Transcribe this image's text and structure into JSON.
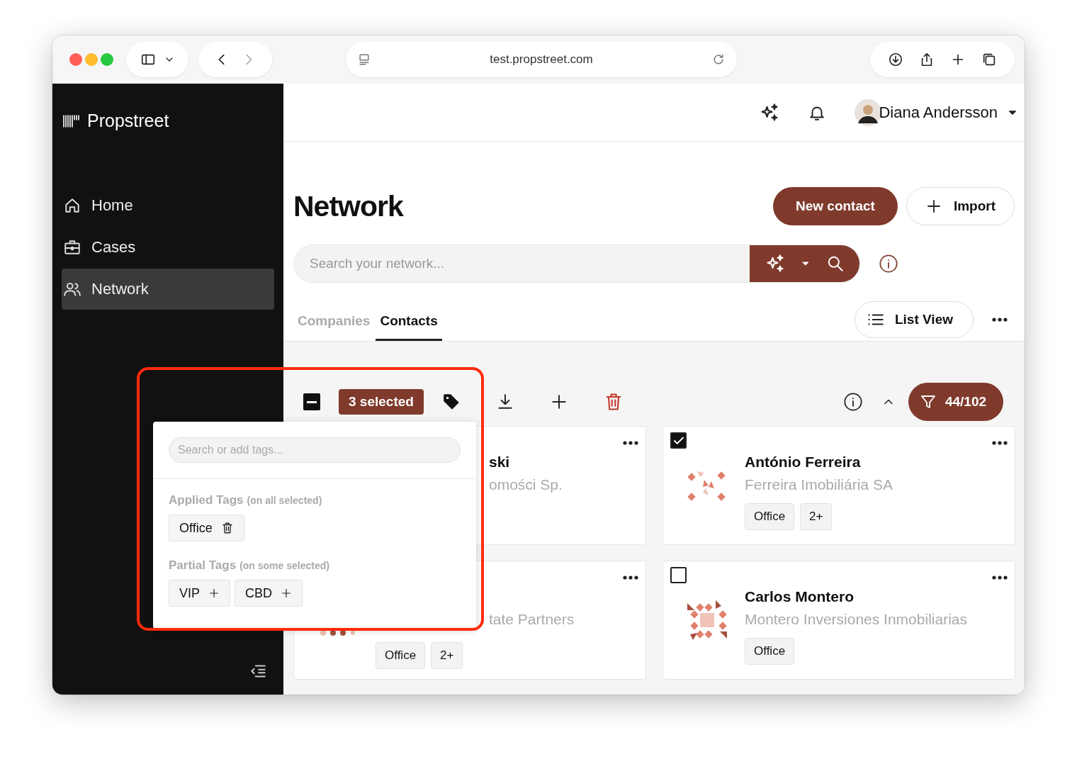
{
  "browser": {
    "url": "test.propstreet.com"
  },
  "sidebar": {
    "logo": "Propstreet",
    "items": [
      {
        "label": "Home",
        "kind": "home",
        "selected": false
      },
      {
        "label": "Cases",
        "kind": "cases",
        "selected": false
      },
      {
        "label": "Network",
        "kind": "network",
        "selected": true
      }
    ]
  },
  "header": {
    "user": "Diana Andersson"
  },
  "page": {
    "title": "Network",
    "new_button": "New contact",
    "import_button": "Import",
    "search": {
      "placeholder": "Search your network..."
    },
    "tabs": [
      {
        "label": "Companies",
        "selected": false
      },
      {
        "label": "Contacts",
        "selected": true
      }
    ],
    "view_button": "List View"
  },
  "toolbar": {
    "select_all": {
      "indeterminate": true
    },
    "selected_count": "3 selected",
    "filter_count": "44/102"
  },
  "tag_popup": {
    "placeholder": "Search or add tags...",
    "applied": {
      "title": "Applied Tags",
      "note": "(on all selected)",
      "tags": [
        "Office"
      ]
    },
    "partial": {
      "title": "Partial Tags",
      "note": "(on some selected)",
      "tags": [
        "VIP",
        "CBD"
      ]
    }
  },
  "contacts": [
    {
      "kind": "covered",
      "name": "ski",
      "company": "omości Sp."
    },
    {
      "kind": "full",
      "checked": true,
      "name": "António Ferreira",
      "company": "Ferreira Imobiliária SA",
      "tags": [
        "Office",
        "2+"
      ]
    },
    {
      "kind": "covered",
      "company": "tate Partners",
      "tags": [
        "Office",
        "2+"
      ]
    },
    {
      "kind": "full",
      "checked": false,
      "name": "Carlos Montero",
      "company": "Montero Inversiones Inmobiliarias",
      "tags": [
        "Office"
      ]
    }
  ]
}
